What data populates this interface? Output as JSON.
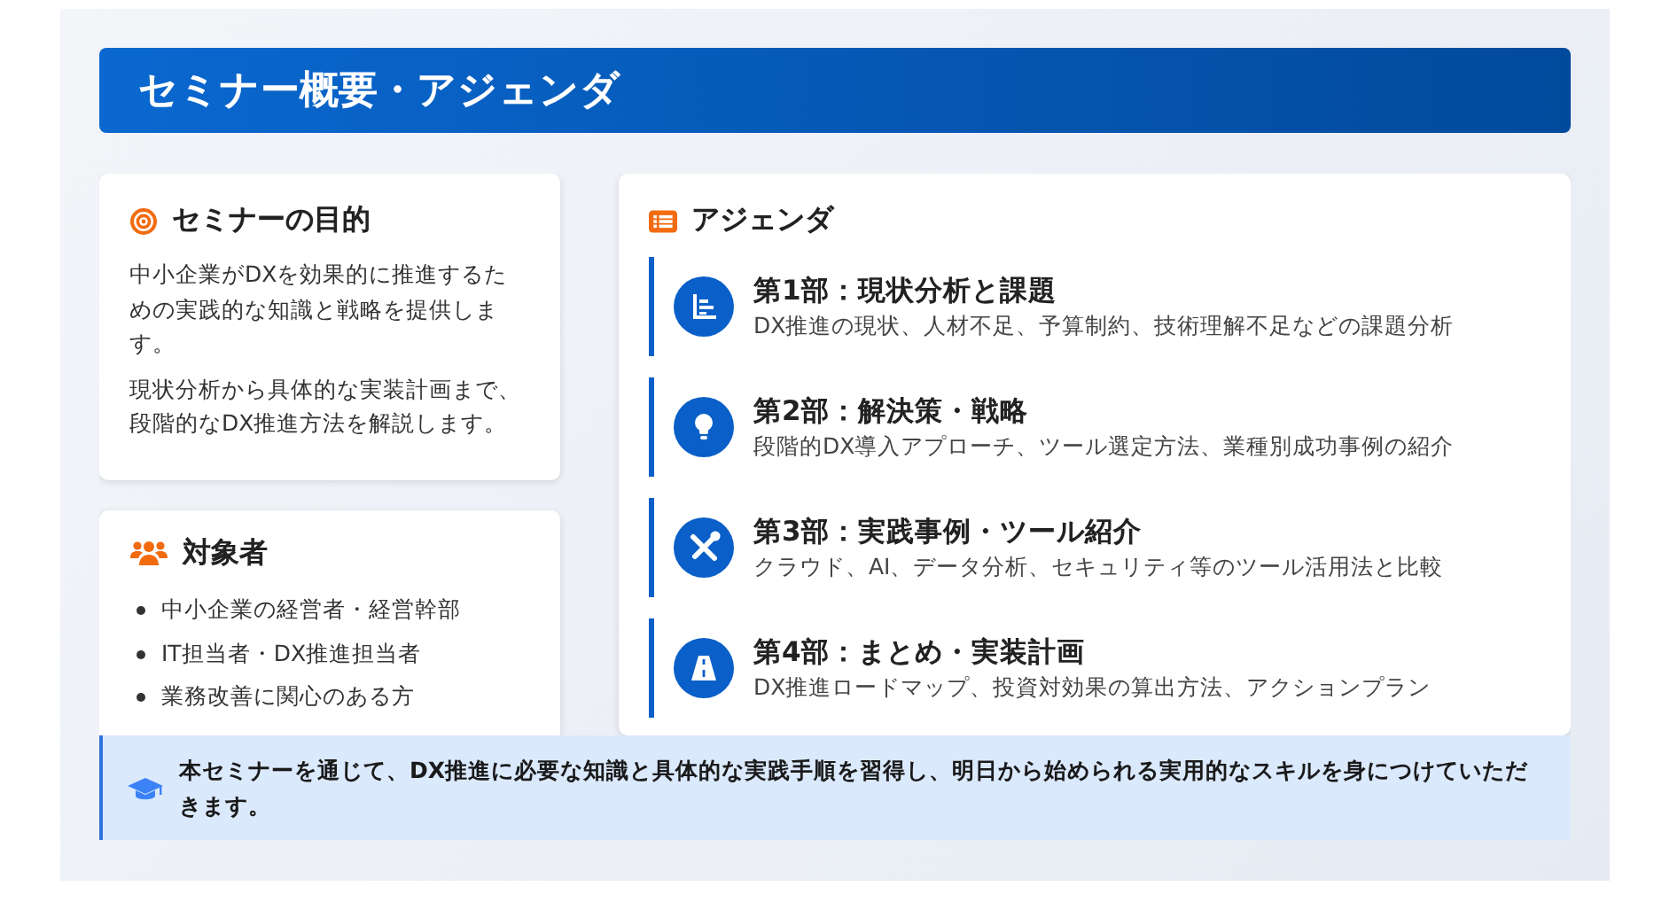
{
  "title": "セミナー概要・アジェンダ",
  "purpose": {
    "heading": "セミナーの目的",
    "paragraphs": [
      "中小企業がDXを効果的に推進するための実践的な知識と戦略を提供します。",
      "現状分析から具体的な実装計画まで、段階的なDX推進方法を解説します。"
    ]
  },
  "audience": {
    "heading": "対象者",
    "items": [
      "中小企業の経営者・経営幹部",
      "IT担当者・DX推進担当者",
      "業務改善に関心のある方"
    ]
  },
  "agenda": {
    "heading": "アジェンダ",
    "items": [
      {
        "kind": "chart",
        "title": "第1部：現状分析と課題",
        "description": "DX推進の現状、人材不足、予算制約、技術理解不足などの課題分析"
      },
      {
        "kind": "bulb",
        "title": "第2部：解決策・戦略",
        "description": "段階的DX導入アプローチ、ツール選定方法、業種別成功事例の紹介"
      },
      {
        "kind": "tools",
        "title": "第3部：実践事例・ツール紹介",
        "description": "クラウド、AI、データ分析、セキュリティ等のツール活用法と比較"
      },
      {
        "kind": "road",
        "title": "第4部：まとめ・実装計画",
        "description": "DX推進ロードマップ、投資対効果の算出方法、アクションプラン"
      }
    ]
  },
  "note": "本セミナーを通じて、DX推進に必要な知識と具体的な実践手順を習得し、明日から始められる実用的なスキルを身につけていただきます。"
}
